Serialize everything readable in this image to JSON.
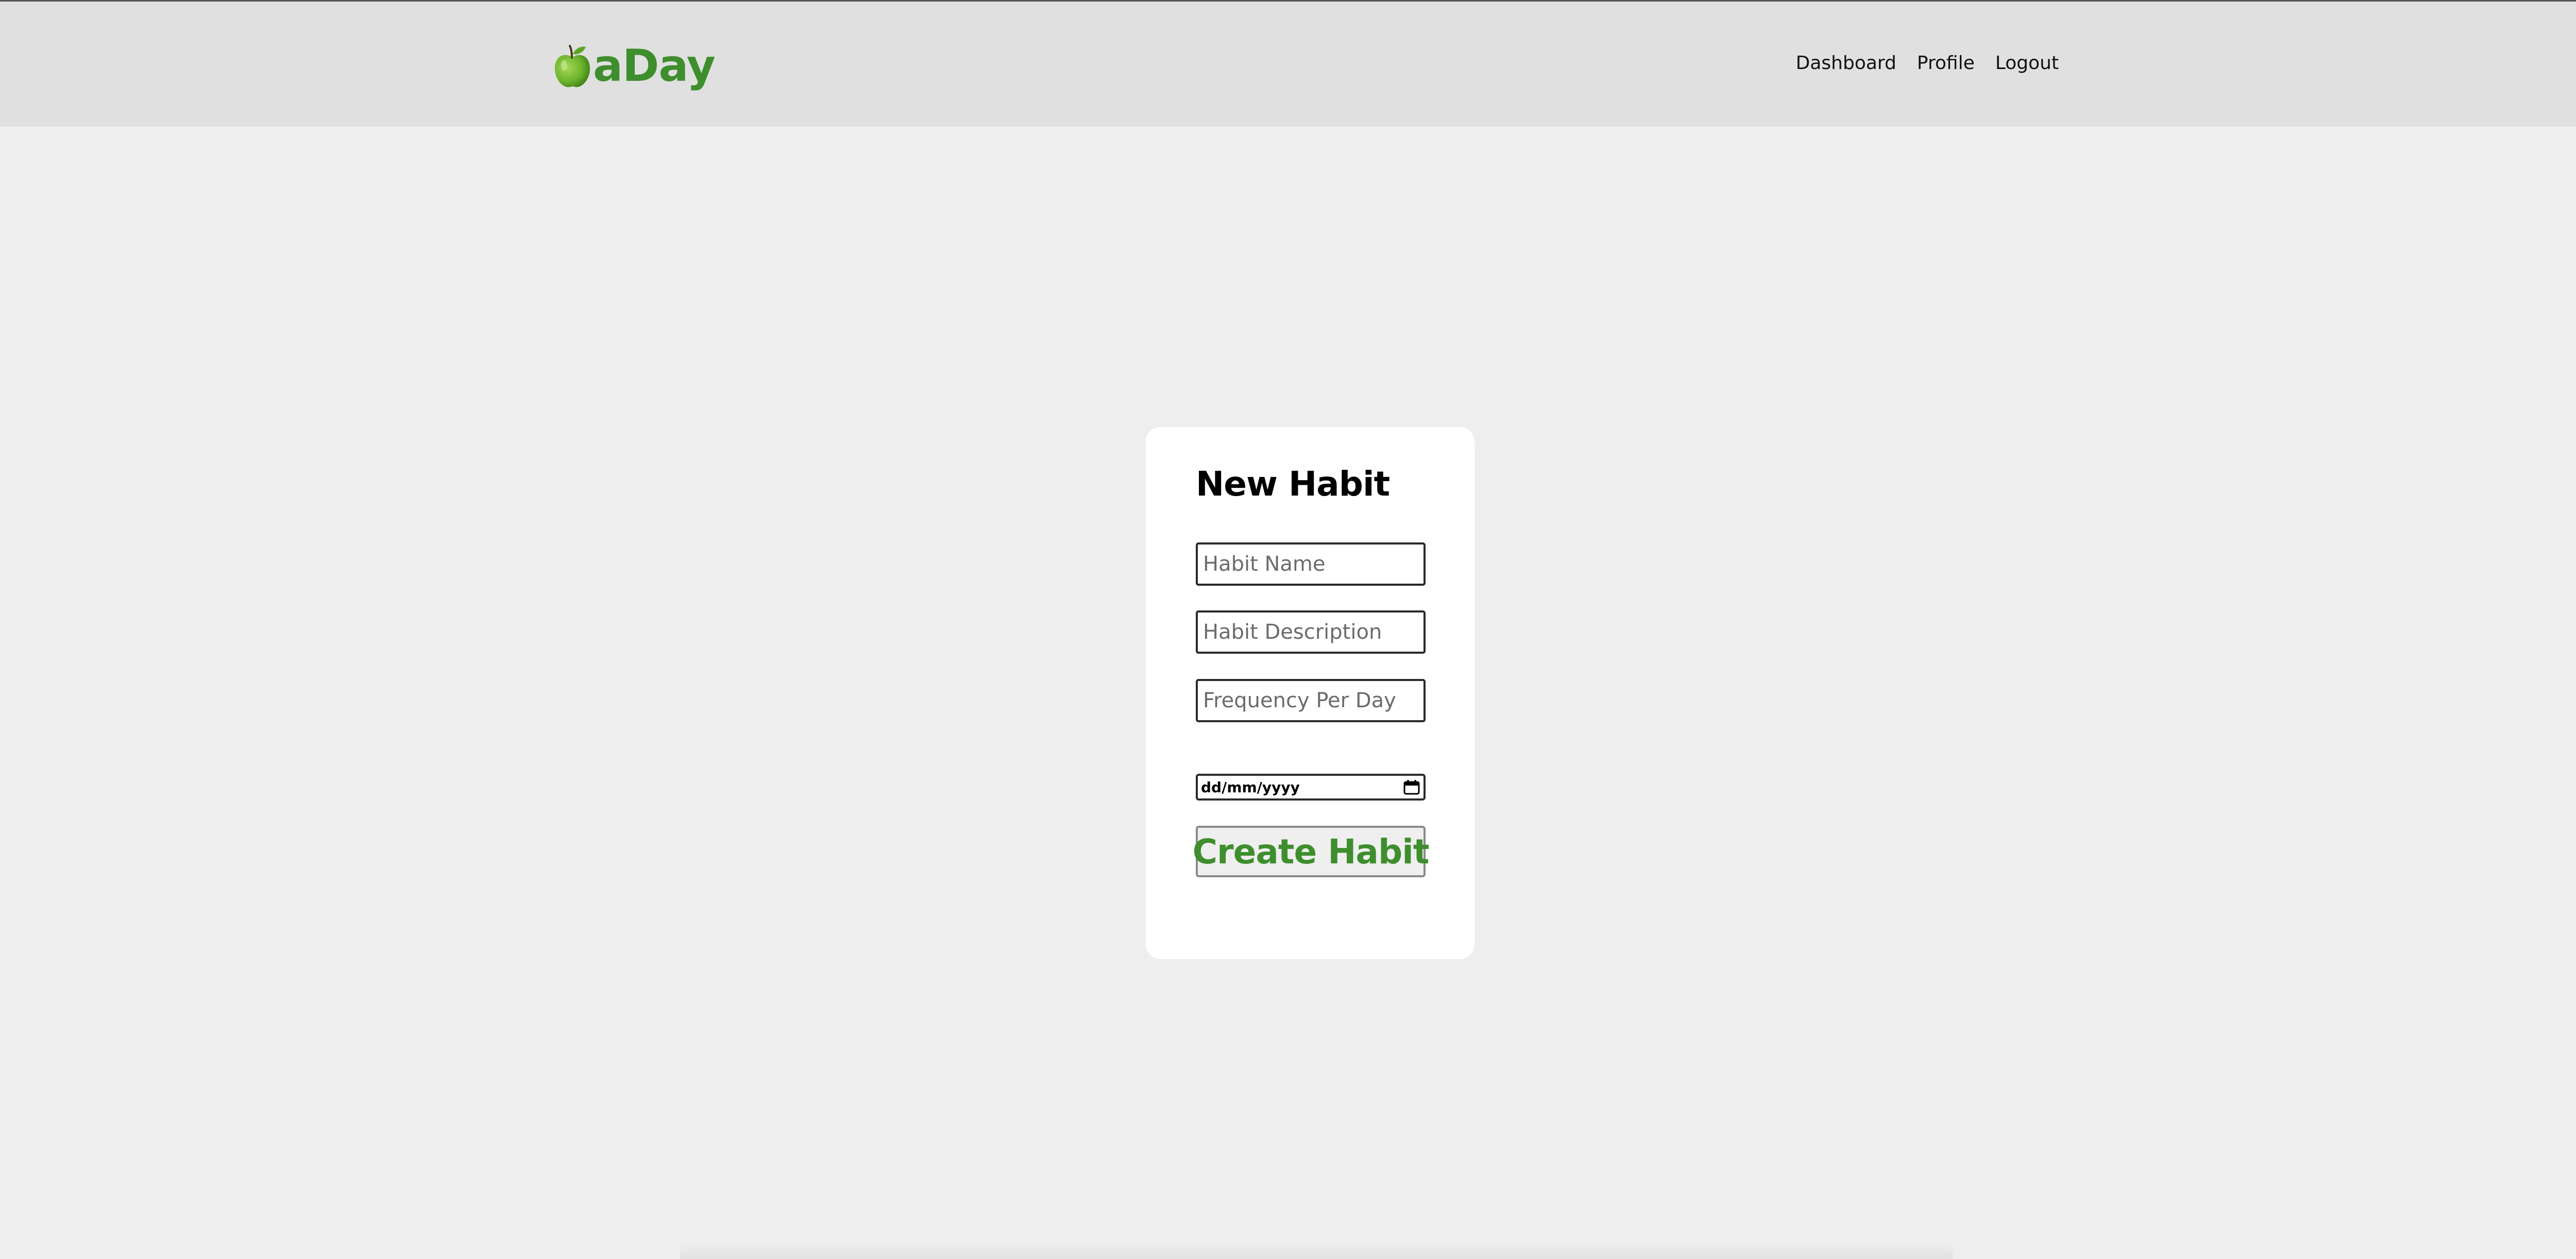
{
  "brand": {
    "name": "aDay",
    "logo_icon": "green-apple-icon",
    "color": "#3e8e2d"
  },
  "nav": {
    "items": [
      {
        "label": "Dashboard"
      },
      {
        "label": "Profile"
      },
      {
        "label": "Logout"
      }
    ]
  },
  "form": {
    "title": "New Habit",
    "name_field": {
      "placeholder": "Habit Name",
      "value": ""
    },
    "description_field": {
      "placeholder": "Habit Description",
      "value": ""
    },
    "frequency_field": {
      "placeholder": "Frequency Per Day",
      "value": ""
    },
    "date_field": {
      "display": "dd/mm/yyyy",
      "icon": "calendar-icon"
    },
    "submit_label": "Create Habit"
  },
  "colors": {
    "background": "#eeeeee",
    "header": "#e0e0e0",
    "card": "#ffffff",
    "accent": "#3e8e2d"
  }
}
